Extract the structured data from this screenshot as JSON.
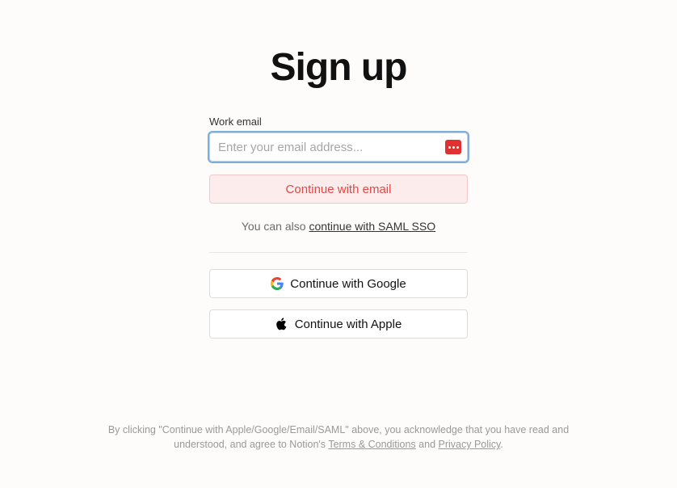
{
  "title": "Sign up",
  "form": {
    "email_label": "Work email",
    "email_placeholder": "Enter your email address...",
    "email_value": "",
    "continue_email_label": "Continue with email"
  },
  "sso": {
    "prefix": "You can also ",
    "link": "continue with SAML SSO"
  },
  "oauth": {
    "google_label": "Continue with Google",
    "apple_label": "Continue with Apple"
  },
  "legal": {
    "text_1": "By clicking \"Continue with Apple/Google/Email/SAML\" above, you acknowledge that you have read and understood, and agree to Notion's ",
    "terms_link": "Terms & Conditions",
    "text_2": " and ",
    "privacy_link": "Privacy Policy",
    "text_3": "."
  },
  "colors": {
    "accent_red": "#e34646",
    "accent_red_bg": "#fdecec",
    "focus_ring": "#7aaedb"
  }
}
